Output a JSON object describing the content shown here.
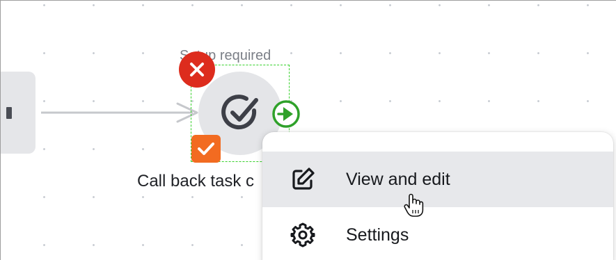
{
  "canvas": {
    "grid_color": "#c9cdd3",
    "background": "#ffffff"
  },
  "node": {
    "status_text": "Setup required",
    "label": "Call back task c",
    "icon": "check-circle-icon",
    "error_badge_icon": "close-icon",
    "error_color": "#dd2c1d",
    "select_badge_icon": "checkmark-icon",
    "select_color": "#f26b21",
    "connector_icon": "play-circle-icon",
    "selection_color": "#36d12a"
  },
  "context_menu": {
    "items": [
      {
        "label": "View and edit",
        "icon": "edit-icon",
        "hovered": true
      },
      {
        "label": "Settings",
        "icon": "gear-icon",
        "hovered": false
      }
    ]
  }
}
